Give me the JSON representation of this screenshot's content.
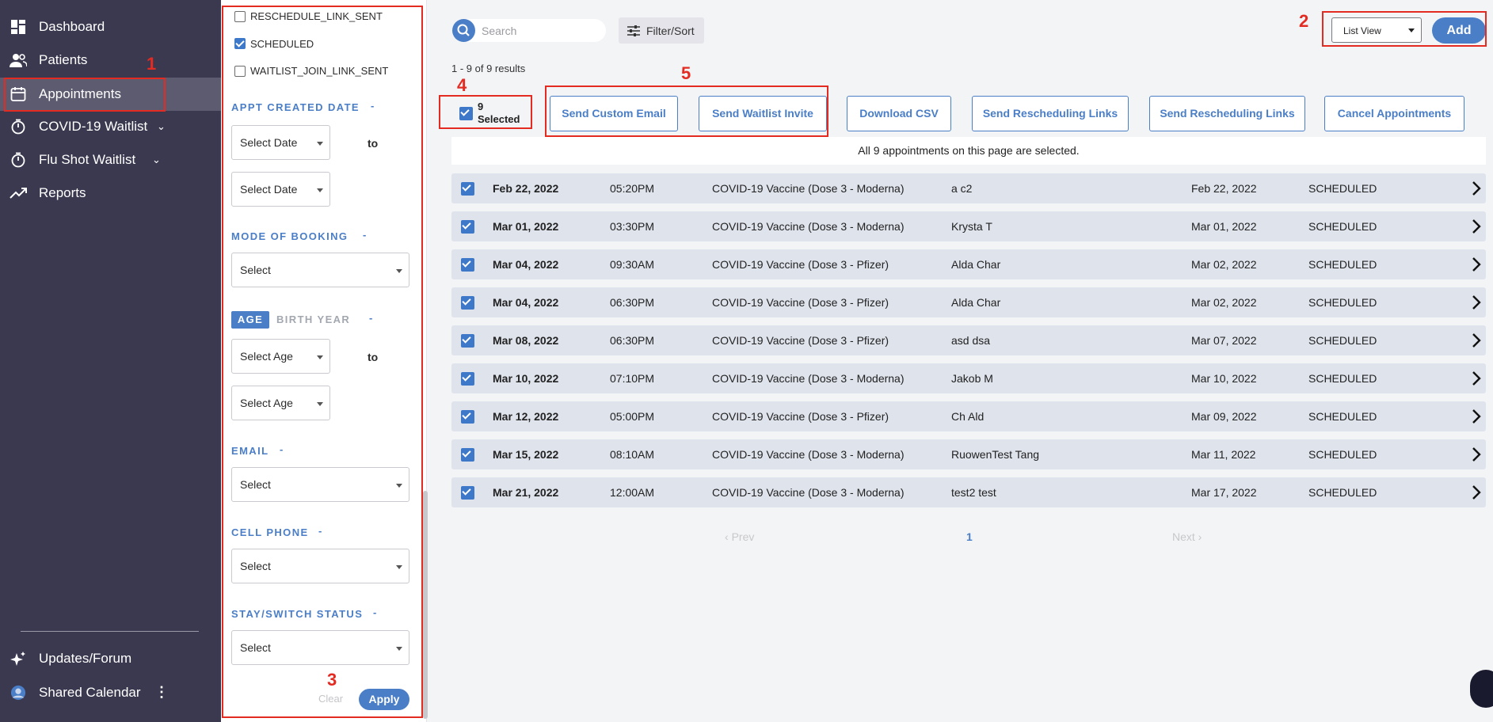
{
  "sidebar": {
    "items": [
      {
        "label": "Dashboard",
        "icon": "dashboard-icon"
      },
      {
        "label": "Patients",
        "icon": "patients-icon"
      },
      {
        "label": "Appointments",
        "icon": "calendar-icon",
        "active": true
      },
      {
        "label": "COVID-19 Waitlist",
        "icon": "timer-icon",
        "expandable": true
      },
      {
        "label": "Flu Shot Waitlist",
        "icon": "timer-icon",
        "expandable": true
      },
      {
        "label": "Reports",
        "icon": "trend-icon"
      }
    ],
    "bottom": [
      {
        "label": "Updates/Forum",
        "icon": "sparkle-icon"
      },
      {
        "label": "Shared Calendar",
        "icon": "avatar-icon"
      }
    ]
  },
  "filters": {
    "status_options": [
      {
        "label": "RESCHEDULE_LINK_SENT",
        "checked": false
      },
      {
        "label": "SCHEDULED",
        "checked": true
      },
      {
        "label": "WAITLIST_JOIN_LINK_SENT",
        "checked": false
      }
    ],
    "appt_created_date": {
      "title": "APPT CREATED DATE",
      "toggle": "-",
      "from": "Select Date",
      "to": "Select Date",
      "to_label": "to"
    },
    "mode_of_booking": {
      "title": "MODE OF BOOKING",
      "toggle": "-",
      "value": "Select"
    },
    "age": {
      "tab_age": "AGE",
      "tab_birth_year": "BIRTH YEAR",
      "toggle": "-",
      "from": "Select Age",
      "to": "Select Age",
      "to_label": "to"
    },
    "email": {
      "title": "EMAIL",
      "toggle": "-",
      "value": "Select"
    },
    "cell_phone": {
      "title": "CELL PHONE",
      "toggle": "-",
      "value": "Select"
    },
    "stay_switch": {
      "title": "STAY/SWITCH STATUS",
      "toggle": "-",
      "value": "Select"
    },
    "clear_label": "Clear",
    "apply_label": "Apply"
  },
  "toolbar": {
    "search_placeholder": "Search",
    "filter_sort_label": "Filter/Sort",
    "view_select": "List View",
    "add_label": "Add"
  },
  "results_text": "1 - 9 of 9 results",
  "selection": {
    "count_label": "9 Selected",
    "all_checked": true
  },
  "actions": [
    "Send Custom Email",
    "Send Waitlist Invite",
    "Download CSV",
    "Send Rescheduling Links",
    "Send Rescheduling Links",
    "Cancel Appointments"
  ],
  "banner_text": "All 9 appointments on this page are selected.",
  "table": {
    "rows": [
      {
        "date": "Feb 22, 2022",
        "time": "05:20PM",
        "service": "COVID-19 Vaccine (Dose 3 - Moderna)",
        "name": "a c2",
        "created": "Feb 22, 2022",
        "status": "SCHEDULED",
        "checked": true
      },
      {
        "date": "Mar 01, 2022",
        "time": "03:30PM",
        "service": "COVID-19 Vaccine (Dose 3 - Moderna)",
        "name": "Krysta T",
        "created": "Mar 01, 2022",
        "status": "SCHEDULED",
        "checked": true
      },
      {
        "date": "Mar 04, 2022",
        "time": "09:30AM",
        "service": "COVID-19 Vaccine (Dose 3 - Pfizer)",
        "name": "Alda Char",
        "created": "Mar 02, 2022",
        "status": "SCHEDULED",
        "checked": true
      },
      {
        "date": "Mar 04, 2022",
        "time": "06:30PM",
        "service": "COVID-19 Vaccine (Dose 3 - Pfizer)",
        "name": "Alda Char",
        "created": "Mar 02, 2022",
        "status": "SCHEDULED",
        "checked": true
      },
      {
        "date": "Mar 08, 2022",
        "time": "06:30PM",
        "service": "COVID-19 Vaccine (Dose 3 - Pfizer)",
        "name": "asd dsa",
        "created": "Mar 07, 2022",
        "status": "SCHEDULED",
        "checked": true
      },
      {
        "date": "Mar 10, 2022",
        "time": "07:10PM",
        "service": "COVID-19 Vaccine (Dose 3 - Moderna)",
        "name": "Jakob M",
        "created": "Mar 10, 2022",
        "status": "SCHEDULED",
        "checked": true
      },
      {
        "date": "Mar 12, 2022",
        "time": "05:00PM",
        "service": "COVID-19 Vaccine (Dose 3 - Pfizer)",
        "name": "Ch Ald",
        "created": "Mar 09, 2022",
        "status": "SCHEDULED",
        "checked": true
      },
      {
        "date": "Mar 15, 2022",
        "time": "08:10AM",
        "service": "COVID-19 Vaccine (Dose 3 - Moderna)",
        "name": "RuowenTest Tang",
        "created": "Mar 11, 2022",
        "status": "SCHEDULED",
        "checked": true
      },
      {
        "date": "Mar 21, 2022",
        "time": "12:00AM",
        "service": "COVID-19 Vaccine (Dose 3 - Moderna)",
        "name": "test2 test",
        "created": "Mar 17, 2022",
        "status": "SCHEDULED",
        "checked": true
      }
    ]
  },
  "pagination": {
    "prev": "Prev",
    "page": "1",
    "next": "Next"
  },
  "annotations": [
    "1",
    "2",
    "3",
    "4",
    "5"
  ],
  "colors": {
    "accent": "#4a7ec7",
    "sidebar": "#3b3950",
    "annotation": "#e32b22",
    "row": "#dfe3ec"
  }
}
